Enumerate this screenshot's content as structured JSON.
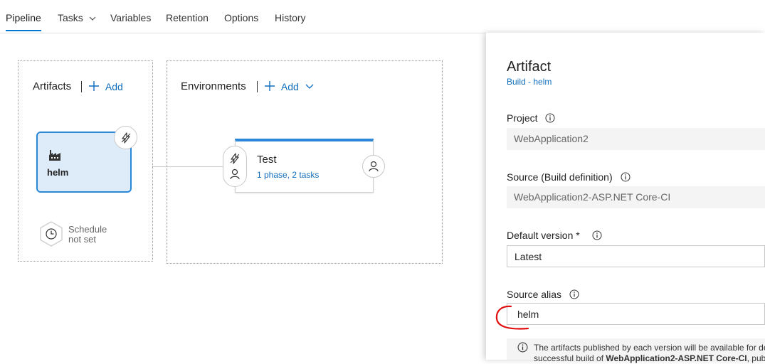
{
  "tabs": {
    "items": [
      {
        "label": "Pipeline"
      },
      {
        "label": "Tasks"
      },
      {
        "label": "Variables"
      },
      {
        "label": "Retention"
      },
      {
        "label": "Options"
      },
      {
        "label": "History"
      }
    ],
    "active": "Pipeline"
  },
  "artifacts": {
    "title": "Artifacts",
    "add_label": "Add",
    "card": {
      "name": "helm",
      "icon": "build-factory-icon",
      "trigger_icon": "lightning-icon"
    },
    "schedule": {
      "line1": "Schedule",
      "line2": "not set",
      "icon": "clock-icon"
    }
  },
  "environments": {
    "title": "Environments",
    "add_label": "Add",
    "card": {
      "name": "Test",
      "summary": "1 phase, 2 tasks"
    }
  },
  "panel": {
    "title": "Artifact",
    "subtitle": "Build - helm",
    "project": {
      "label": "Project",
      "value": "WebApplication2"
    },
    "source": {
      "label": "Source (Build definition)",
      "value": "WebApplication2-ASP.NET Core-CI"
    },
    "default_version": {
      "label": "Default version *",
      "value": "Latest"
    },
    "source_alias": {
      "label": "Source alias",
      "value": "helm"
    },
    "message": {
      "line1": "The artifacts published by each version will be available for dep",
      "line2_prefix": "successful build of ",
      "line2_bold": "WebApplication2-ASP.NET Core-CI",
      "line2_suffix": ", publi"
    }
  },
  "colors": {
    "accent": "#0078d4",
    "link": "#106ebe",
    "card_fill": "#deecf9",
    "annotation": "#e01010"
  }
}
